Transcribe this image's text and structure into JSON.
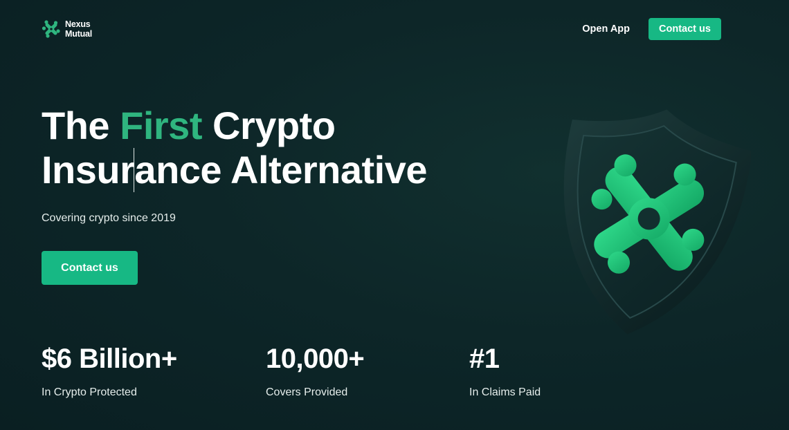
{
  "header": {
    "logo_line1": "Nexus",
    "logo_line2": "Mutual",
    "open_app_label": "Open App",
    "contact_label": "Contact us"
  },
  "hero": {
    "title_the": "The",
    "title_first": "First",
    "title_crypto": "Crypto",
    "title_line2_a": "Insur",
    "title_line2_b": "ance Alternative",
    "subtitle": "Covering crypto since 2019",
    "cta_label": "Contact us"
  },
  "stats": [
    {
      "value": "$6 Billion+",
      "label": "In Crypto Protected"
    },
    {
      "value": "10,000+",
      "label": "Covers Provided"
    },
    {
      "value": "#1",
      "label": "In Claims Paid"
    }
  ],
  "colors": {
    "accent": "#17b884",
    "accent_text": "#2fb57f",
    "background": "#0d2628"
  },
  "icons": [
    "nexus-logo-icon",
    "shield-logo-icon"
  ]
}
